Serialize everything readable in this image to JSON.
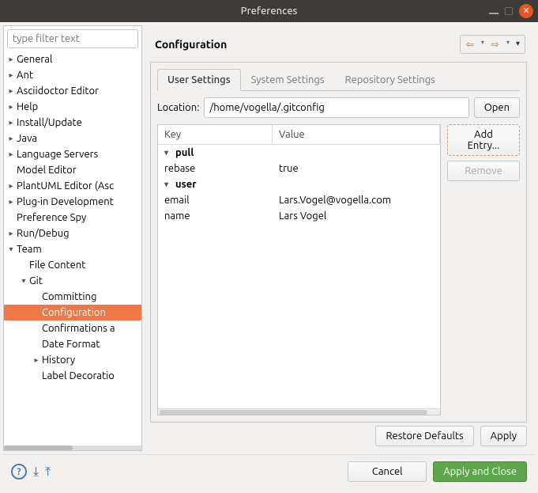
{
  "window": {
    "title": "Preferences"
  },
  "filter": {
    "placeholder": "type filter text"
  },
  "tree": {
    "items": [
      {
        "label": "General",
        "indent": 0,
        "arrow": "▸"
      },
      {
        "label": "Ant",
        "indent": 0,
        "arrow": "▸"
      },
      {
        "label": "Asciidoctor Editor",
        "indent": 0,
        "arrow": "▸"
      },
      {
        "label": "Help",
        "indent": 0,
        "arrow": "▸"
      },
      {
        "label": "Install/Update",
        "indent": 0,
        "arrow": "▸"
      },
      {
        "label": "Java",
        "indent": 0,
        "arrow": "▸"
      },
      {
        "label": "Language Servers",
        "indent": 0,
        "arrow": "▸"
      },
      {
        "label": "Model Editor",
        "indent": 0,
        "arrow": ""
      },
      {
        "label": "PlantUML Editor (Asc",
        "indent": 0,
        "arrow": "▸"
      },
      {
        "label": "Plug-in Development",
        "indent": 0,
        "arrow": "▸"
      },
      {
        "label": "Preference Spy",
        "indent": 0,
        "arrow": ""
      },
      {
        "label": "Run/Debug",
        "indent": 0,
        "arrow": "▸"
      },
      {
        "label": "Team",
        "indent": 0,
        "arrow": "▾"
      },
      {
        "label": "File Content",
        "indent": 1,
        "arrow": ""
      },
      {
        "label": "Git",
        "indent": 1,
        "arrow": "▾"
      },
      {
        "label": "Committing",
        "indent": 2,
        "arrow": ""
      },
      {
        "label": "Configuration",
        "indent": 2,
        "arrow": "",
        "selected": true
      },
      {
        "label": "Confirmations a",
        "indent": 2,
        "arrow": ""
      },
      {
        "label": "Date Format",
        "indent": 2,
        "arrow": ""
      },
      {
        "label": "History",
        "indent": 2,
        "arrow": "▸"
      },
      {
        "label": "Label Decoratio",
        "indent": 2,
        "arrow": ""
      }
    ]
  },
  "page": {
    "title": "Configuration",
    "tabs": [
      {
        "label": "User Settings",
        "active": true
      },
      {
        "label": "System Settings",
        "active": false
      },
      {
        "label": "Repository Settings",
        "active": false
      }
    ],
    "location_label": "Location:",
    "location_value": "/home/vogella/.gitconfig",
    "open_label": "Open",
    "table": {
      "key_header": "Key",
      "value_header": "Value",
      "rows": [
        {
          "key": "pull",
          "value": "",
          "group": true,
          "arrow": "▾"
        },
        {
          "key": "rebase",
          "value": "true",
          "group": false
        },
        {
          "key": "user",
          "value": "",
          "group": true,
          "arrow": "▾"
        },
        {
          "key": "email",
          "value": "Lars.Vogel@vogella.com",
          "group": false
        },
        {
          "key": "name",
          "value": "Lars Vogel",
          "group": false
        }
      ]
    },
    "add_entry_label": "Add Entry...",
    "remove_label": "Remove",
    "restore_label": "Restore Defaults",
    "apply_label": "Apply"
  },
  "footer": {
    "cancel": "Cancel",
    "apply_close": "Apply and Close"
  }
}
